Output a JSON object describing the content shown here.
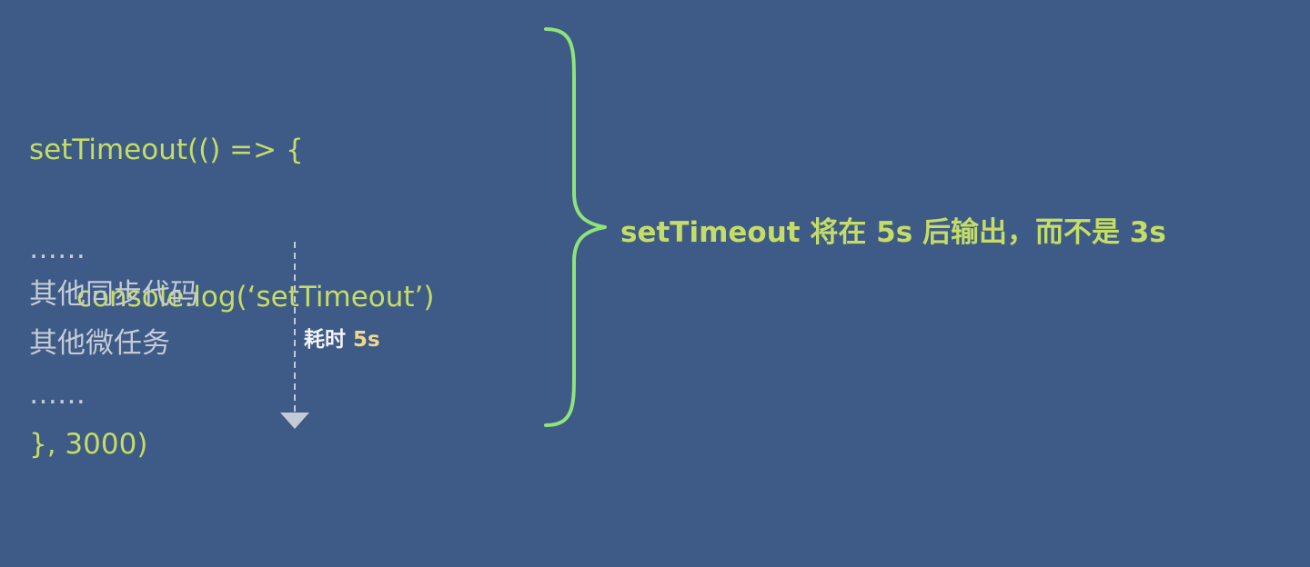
{
  "code": {
    "line1": "setTimeout(() => {",
    "line2": "console.log(‘setTimeout’)",
    "line3": "}, 3000)"
  },
  "steps": {
    "dots_top": "……",
    "sync_code": "其他同步代码",
    "micro_tasks": "其他微任务",
    "dots_bottom": "……"
  },
  "duration": {
    "prefix": "耗时",
    "value": "5s"
  },
  "result": {
    "text": "setTimeout 将在 5s 后输出，而不是 3s"
  },
  "colors": {
    "background": "#3e5a86",
    "code_green": "#c4dd67",
    "brace_green": "#8ee37b",
    "gray_text": "#c4cbd6",
    "time_value": "#f0d88d"
  }
}
